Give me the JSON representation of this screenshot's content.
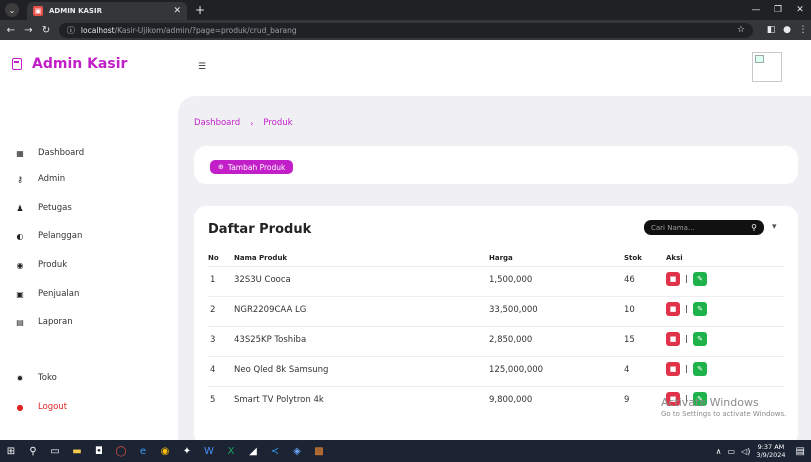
{
  "browser": {
    "tab_title": "ADMIN KASIR",
    "url_host": "localhost",
    "url_path": "/Kasir-Ujikom/admin/?page=produk/crud_barang"
  },
  "sidebar": {
    "brand": "Admin Kasir",
    "items": [
      {
        "label": "Dashboard"
      },
      {
        "label": "Admin"
      },
      {
        "label": "Petugas"
      },
      {
        "label": "Pelanggan"
      },
      {
        "label": "Produk"
      },
      {
        "label": "Penjualan"
      },
      {
        "label": "Laporan"
      },
      {
        "label": "Toko"
      },
      {
        "label": "Logout"
      }
    ]
  },
  "breadcrumb": {
    "home": "Dashboard",
    "current": "Produk"
  },
  "actions": {
    "add_label": "Tambah Produk"
  },
  "product_list": {
    "title": "Daftar Produk",
    "search_placeholder": "Cari Nama...",
    "columns": [
      "No",
      "Nama Produk",
      "Harga",
      "Stok",
      "Aksi"
    ],
    "rows": [
      {
        "no": "1",
        "name": "32S3U Cooca",
        "price": "1,500,000",
        "stock": "46"
      },
      {
        "no": "2",
        "name": "NGR2209CAA LG",
        "price": "33,500,000",
        "stock": "10"
      },
      {
        "no": "3",
        "name": "43S25KP Toshiba",
        "price": "2,850,000",
        "stock": "15"
      },
      {
        "no": "4",
        "name": "Neo Qled 8k Samsung",
        "price": "125,000,000",
        "stock": "4"
      },
      {
        "no": "5",
        "name": "Smart TV Polytron 4k",
        "price": "9,800,000",
        "stock": "9"
      }
    ]
  },
  "watermark": {
    "title": "Activate Windows",
    "subtitle": "Go to Settings to activate Windows."
  },
  "taskbar": {
    "time": "9:37 AM",
    "date": "3/9/2024"
  },
  "colors": {
    "accent": "#c21fc9",
    "delete": "#e0334a",
    "edit": "#1fb14a",
    "content_bg": "#f0f0f4"
  }
}
